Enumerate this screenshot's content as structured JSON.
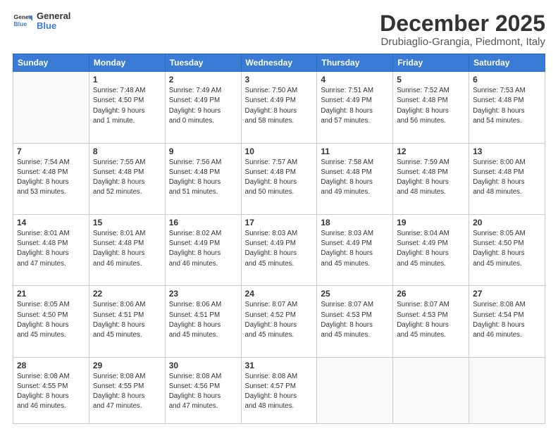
{
  "header": {
    "logo": {
      "general": "General",
      "blue": "Blue"
    },
    "title": "December 2025",
    "location": "Drubiaglio-Grangia, Piedmont, Italy"
  },
  "days_of_week": [
    "Sunday",
    "Monday",
    "Tuesday",
    "Wednesday",
    "Thursday",
    "Friday",
    "Saturday"
  ],
  "weeks": [
    [
      {
        "day": "",
        "info": ""
      },
      {
        "day": "1",
        "info": "Sunrise: 7:48 AM\nSunset: 4:50 PM\nDaylight: 9 hours\nand 1 minute."
      },
      {
        "day": "2",
        "info": "Sunrise: 7:49 AM\nSunset: 4:49 PM\nDaylight: 9 hours\nand 0 minutes."
      },
      {
        "day": "3",
        "info": "Sunrise: 7:50 AM\nSunset: 4:49 PM\nDaylight: 8 hours\nand 58 minutes."
      },
      {
        "day": "4",
        "info": "Sunrise: 7:51 AM\nSunset: 4:49 PM\nDaylight: 8 hours\nand 57 minutes."
      },
      {
        "day": "5",
        "info": "Sunrise: 7:52 AM\nSunset: 4:48 PM\nDaylight: 8 hours\nand 56 minutes."
      },
      {
        "day": "6",
        "info": "Sunrise: 7:53 AM\nSunset: 4:48 PM\nDaylight: 8 hours\nand 54 minutes."
      }
    ],
    [
      {
        "day": "7",
        "info": "Sunrise: 7:54 AM\nSunset: 4:48 PM\nDaylight: 8 hours\nand 53 minutes."
      },
      {
        "day": "8",
        "info": "Sunrise: 7:55 AM\nSunset: 4:48 PM\nDaylight: 8 hours\nand 52 minutes."
      },
      {
        "day": "9",
        "info": "Sunrise: 7:56 AM\nSunset: 4:48 PM\nDaylight: 8 hours\nand 51 minutes."
      },
      {
        "day": "10",
        "info": "Sunrise: 7:57 AM\nSunset: 4:48 PM\nDaylight: 8 hours\nand 50 minutes."
      },
      {
        "day": "11",
        "info": "Sunrise: 7:58 AM\nSunset: 4:48 PM\nDaylight: 8 hours\nand 49 minutes."
      },
      {
        "day": "12",
        "info": "Sunrise: 7:59 AM\nSunset: 4:48 PM\nDaylight: 8 hours\nand 48 minutes."
      },
      {
        "day": "13",
        "info": "Sunrise: 8:00 AM\nSunset: 4:48 PM\nDaylight: 8 hours\nand 48 minutes."
      }
    ],
    [
      {
        "day": "14",
        "info": "Sunrise: 8:01 AM\nSunset: 4:48 PM\nDaylight: 8 hours\nand 47 minutes."
      },
      {
        "day": "15",
        "info": "Sunrise: 8:01 AM\nSunset: 4:48 PM\nDaylight: 8 hours\nand 46 minutes."
      },
      {
        "day": "16",
        "info": "Sunrise: 8:02 AM\nSunset: 4:49 PM\nDaylight: 8 hours\nand 46 minutes."
      },
      {
        "day": "17",
        "info": "Sunrise: 8:03 AM\nSunset: 4:49 PM\nDaylight: 8 hours\nand 45 minutes."
      },
      {
        "day": "18",
        "info": "Sunrise: 8:03 AM\nSunset: 4:49 PM\nDaylight: 8 hours\nand 45 minutes."
      },
      {
        "day": "19",
        "info": "Sunrise: 8:04 AM\nSunset: 4:49 PM\nDaylight: 8 hours\nand 45 minutes."
      },
      {
        "day": "20",
        "info": "Sunrise: 8:05 AM\nSunset: 4:50 PM\nDaylight: 8 hours\nand 45 minutes."
      }
    ],
    [
      {
        "day": "21",
        "info": "Sunrise: 8:05 AM\nSunset: 4:50 PM\nDaylight: 8 hours\nand 45 minutes."
      },
      {
        "day": "22",
        "info": "Sunrise: 8:06 AM\nSunset: 4:51 PM\nDaylight: 8 hours\nand 45 minutes."
      },
      {
        "day": "23",
        "info": "Sunrise: 8:06 AM\nSunset: 4:51 PM\nDaylight: 8 hours\nand 45 minutes."
      },
      {
        "day": "24",
        "info": "Sunrise: 8:07 AM\nSunset: 4:52 PM\nDaylight: 8 hours\nand 45 minutes."
      },
      {
        "day": "25",
        "info": "Sunrise: 8:07 AM\nSunset: 4:53 PM\nDaylight: 8 hours\nand 45 minutes."
      },
      {
        "day": "26",
        "info": "Sunrise: 8:07 AM\nSunset: 4:53 PM\nDaylight: 8 hours\nand 45 minutes."
      },
      {
        "day": "27",
        "info": "Sunrise: 8:08 AM\nSunset: 4:54 PM\nDaylight: 8 hours\nand 46 minutes."
      }
    ],
    [
      {
        "day": "28",
        "info": "Sunrise: 8:08 AM\nSunset: 4:55 PM\nDaylight: 8 hours\nand 46 minutes."
      },
      {
        "day": "29",
        "info": "Sunrise: 8:08 AM\nSunset: 4:55 PM\nDaylight: 8 hours\nand 47 minutes."
      },
      {
        "day": "30",
        "info": "Sunrise: 8:08 AM\nSunset: 4:56 PM\nDaylight: 8 hours\nand 47 minutes."
      },
      {
        "day": "31",
        "info": "Sunrise: 8:08 AM\nSunset: 4:57 PM\nDaylight: 8 hours\nand 48 minutes."
      },
      {
        "day": "",
        "info": ""
      },
      {
        "day": "",
        "info": ""
      },
      {
        "day": "",
        "info": ""
      }
    ]
  ]
}
